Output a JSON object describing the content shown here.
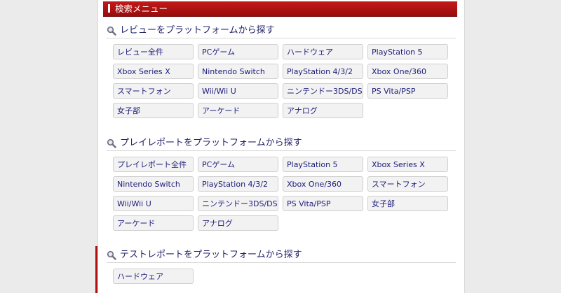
{
  "header": {
    "title": "検索メニュー"
  },
  "sections": [
    {
      "title": "レビューをプラットフォームから探す",
      "items": [
        "レビュー全件",
        "PCゲーム",
        "ハードウェア",
        "PlayStation 5",
        "Xbox Series X",
        "Nintendo Switch",
        "PlayStation 4/3/2",
        "Xbox One/360",
        "スマートフォン",
        "Wii/Wii U",
        "ニンテンドー3DS/DS",
        "PS Vita/PSP",
        "女子部",
        "アーケード",
        "アナログ"
      ]
    },
    {
      "title": "プレイレポートをプラットフォームから探す",
      "items": [
        "プレイレポート全件",
        "PCゲーム",
        "PlayStation 5",
        "Xbox Series X",
        "Nintendo Switch",
        "PlayStation 4/3/2",
        "Xbox One/360",
        "スマートフォン",
        "Wii/Wii U",
        "ニンテンドー3DS/DS",
        "PS Vita/PSP",
        "女子部",
        "アーケード",
        "アナログ"
      ]
    },
    {
      "title": "テストレポートをプラットフォームから探す",
      "items": [
        "ハードウェア"
      ]
    }
  ],
  "colors": {
    "accent": "#b01010",
    "link": "#1d1d7a",
    "title": "#23236a"
  },
  "icons": {
    "section": "search-icon"
  }
}
